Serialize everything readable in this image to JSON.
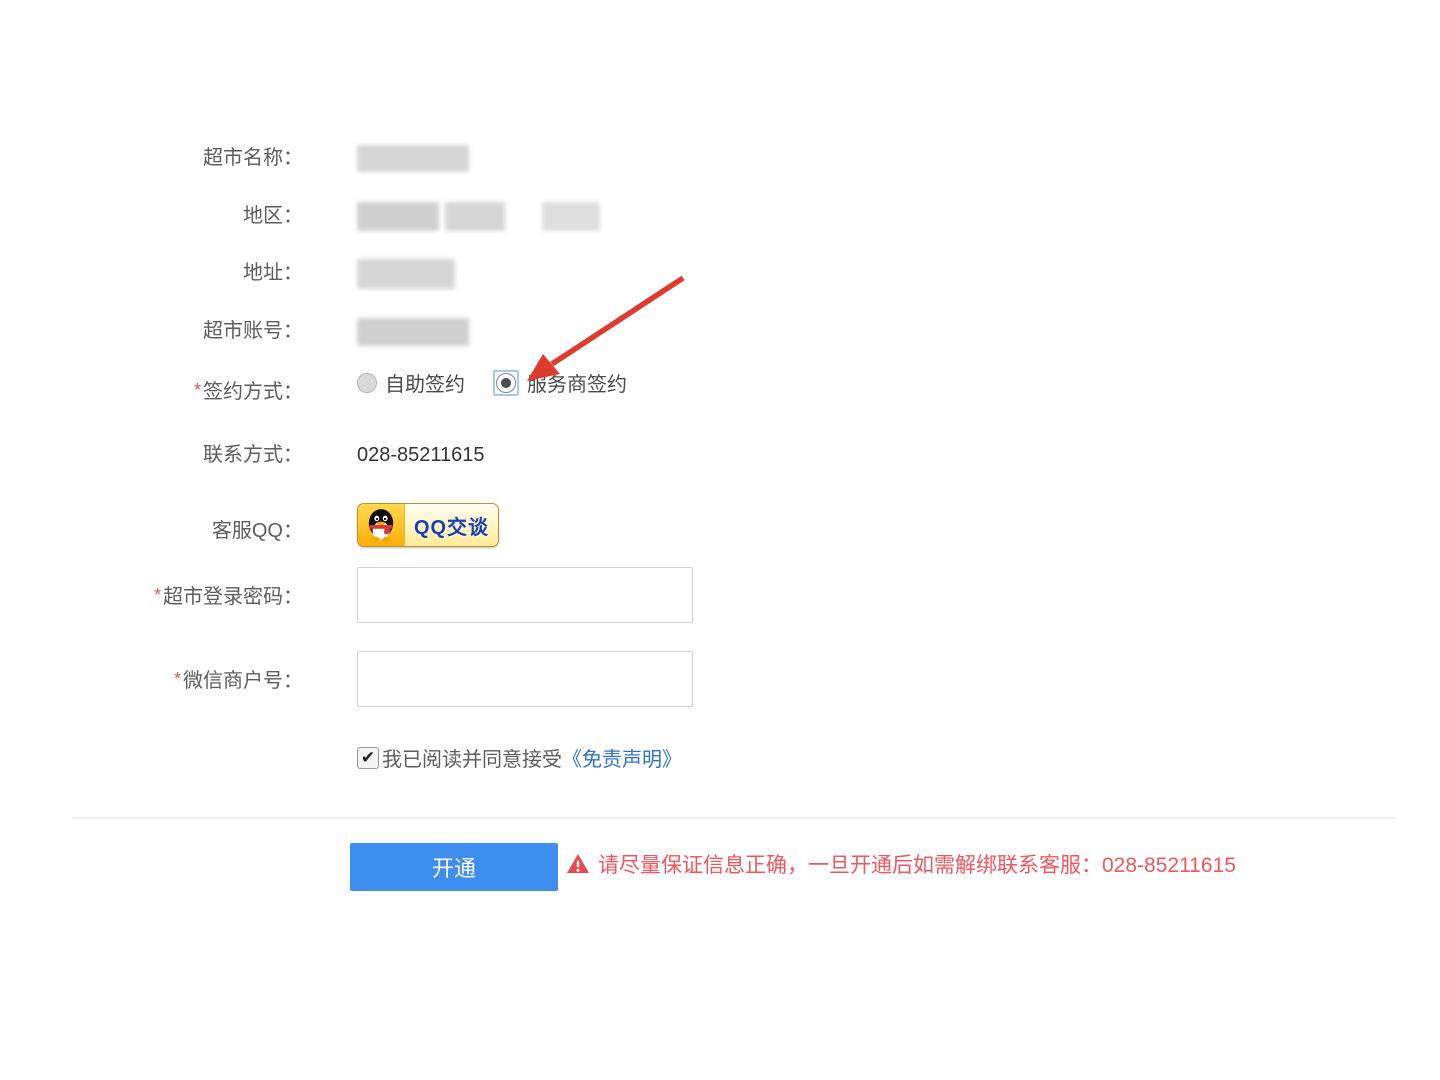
{
  "form": {
    "supermarket_name": {
      "label": "超市名称：",
      "value_redacted": true
    },
    "region": {
      "label": "地区：",
      "value_redacted": true
    },
    "address": {
      "label": "地址：",
      "value_redacted": true
    },
    "account": {
      "label": "超市账号：",
      "value_redacted": true
    },
    "sign_method": {
      "required_mark": "*",
      "label": "签约方式：",
      "options": [
        {
          "label": "自助签约",
          "selected": false
        },
        {
          "label": "服务商签约",
          "selected": true
        }
      ]
    },
    "contact": {
      "label": "联系方式：",
      "value": "028-85211615"
    },
    "qq": {
      "label": "客服QQ：",
      "button_label": "QQ交谈"
    },
    "login_password": {
      "required_mark": "*",
      "label": "超市登录密码：",
      "value": "",
      "placeholder": ""
    },
    "wechat_merchant_id": {
      "required_mark": "*",
      "label": "微信商户号：",
      "value": "",
      "placeholder": ""
    },
    "agreement": {
      "checked": true,
      "checkmark": "✔",
      "text": "我已阅读并同意接受",
      "link_label": "《免责声明》"
    }
  },
  "footer": {
    "submit_label": "开通",
    "warning_text": "请尽量保证信息正确，一旦开通后如需解绑联系客服：028-85211615"
  },
  "colors": {
    "accent_blue": "#3e8ef0",
    "warning_red": "#f0575c",
    "link_blue": "#3173c8",
    "arrow_red": "#df3a2e",
    "label_grey": "#5d5d5d"
  }
}
